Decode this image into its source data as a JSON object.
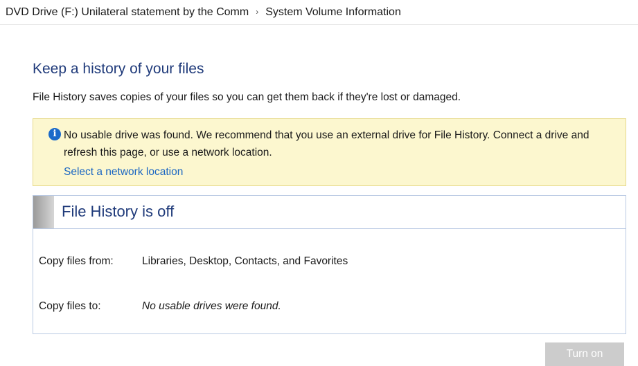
{
  "breadcrumb": {
    "items": [
      "DVD Drive (F:) Unilateral statement by the Comm",
      "System Volume Information"
    ],
    "separator": "›"
  },
  "page": {
    "title": "Keep a history of your files",
    "subtitle": "File History saves copies of your files so you can get them back if they're lost or damaged."
  },
  "info": {
    "icon": "info-icon",
    "icon_glyph": "i",
    "message": "No usable drive was found. We recommend that you use an external drive for File History. Connect a drive and refresh this page, or use a network location.",
    "link": "Select a network location",
    "background": "#fcf7cf"
  },
  "status": {
    "title": "File History is off",
    "rows": [
      {
        "label": "Copy files from:",
        "value": "Libraries, Desktop, Contacts, and Favorites"
      },
      {
        "label": "Copy files to:",
        "value": "No usable drives were found."
      }
    ]
  },
  "actions": {
    "turn_on_label": "Turn on",
    "turn_on_enabled": false
  },
  "colors": {
    "heading": "#1f3a7a",
    "link": "#1a66c2",
    "panel_border": "#b9c9e3",
    "disabled_button": "#cccccc"
  }
}
